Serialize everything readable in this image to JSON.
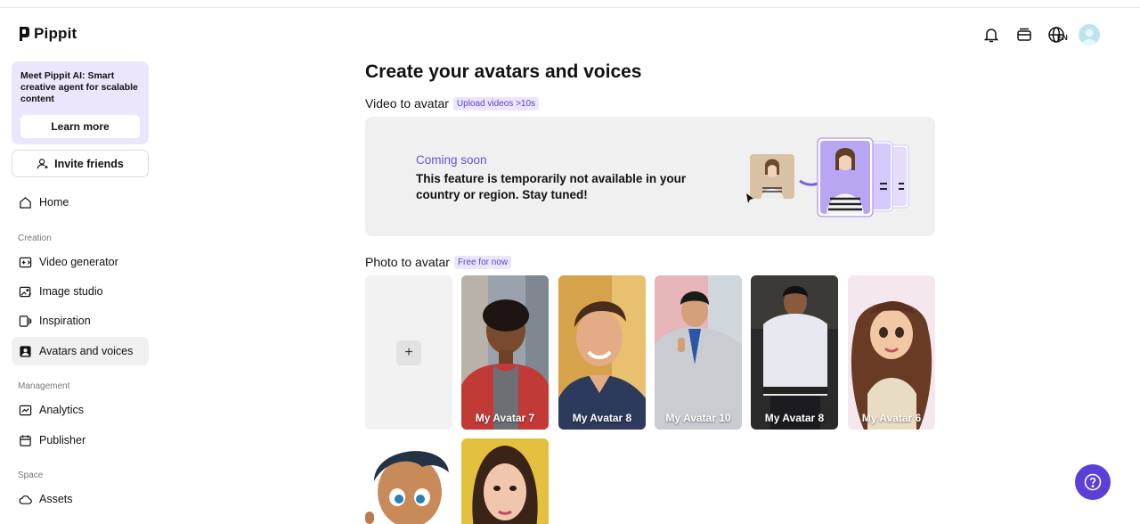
{
  "app": {
    "name": "Pippit"
  },
  "promo": {
    "text": "Meet Pippit AI: Smart creative agent for scalable content",
    "button": "Learn more"
  },
  "invite": {
    "label": "Invite friends"
  },
  "nav": {
    "home": "Home",
    "section_creation": "Creation",
    "video_generator": "Video generator",
    "image_studio": "Image studio",
    "inspiration": "Inspiration",
    "avatars_voices": "Avatars and voices",
    "section_management": "Management",
    "analytics": "Analytics",
    "publisher": "Publisher",
    "section_space": "Space",
    "assets": "Assets"
  },
  "topbar": {
    "lang": "EN",
    "icons": [
      "bell-icon",
      "stack-icon",
      "globe-icon",
      "user-avatar"
    ]
  },
  "main": {
    "title": "Create your avatars and voices",
    "video_section": {
      "title": "Video to avatar",
      "tag": "Upload videos >10s"
    },
    "coming_soon": {
      "title": "Coming soon",
      "body": "This feature is temporarily not available in your country or region. Stay tuned!"
    },
    "photo_section": {
      "title": "Photo to avatar",
      "tag": "Free for now"
    },
    "add_label": "+",
    "avatars": [
      {
        "label": "My Avatar 7"
      },
      {
        "label": "My Avatar 8"
      },
      {
        "label": "My Avatar 10"
      },
      {
        "label": "My Avatar 8"
      },
      {
        "label": "My Avatar 6"
      }
    ]
  },
  "colors": {
    "accent": "#5b3fd6",
    "promo_bg": "#ece6fc",
    "card_bg": "#f0f0f0"
  }
}
